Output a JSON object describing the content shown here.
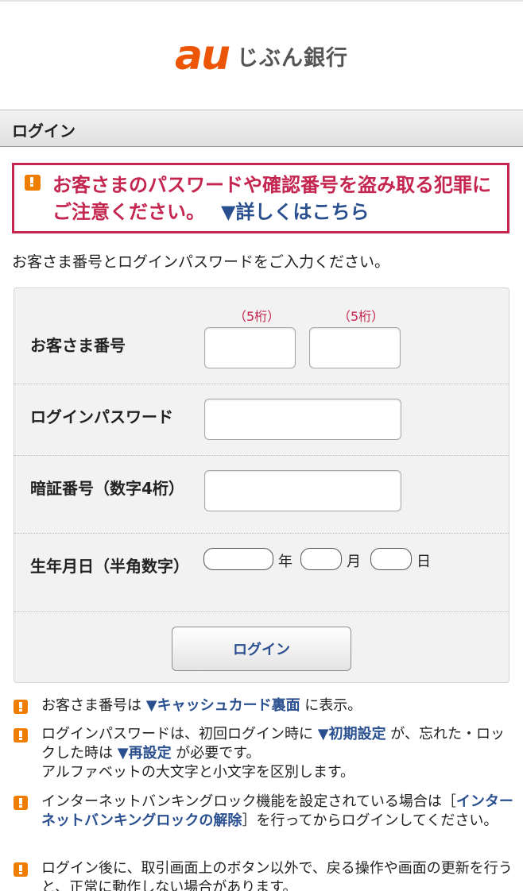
{
  "header": {
    "logo_au": "au",
    "logo_name": "じぶん銀行"
  },
  "title": "ログイン",
  "warning": {
    "text": "お客さまのパスワードや確認番号を盗み取る犯罪にご注意ください。",
    "link": "▼詳しくはこちら"
  },
  "instruction": "お客さま番号とログインパスワードをご入力ください。",
  "form": {
    "customer_number": {
      "label": "お客さま番号",
      "hint1": "（5桁）",
      "hint2": "（5桁）"
    },
    "password": {
      "label": "ログインパスワード"
    },
    "pin": {
      "label": "暗証番号（数字4桁）"
    },
    "birthdate": {
      "label": "生年月日（半角数字）",
      "year": "年",
      "month": "月",
      "day": "日"
    },
    "submit": "ログイン"
  },
  "notes": [
    {
      "before": "お客さま番号は ",
      "link": "▼キャッシュカード裏面",
      "after": " に表示。"
    },
    {
      "before": "ログインパスワードは、初回ログイン時に ",
      "link1": "▼初期設定",
      "mid": " が、忘れた・ロックした時は ",
      "link2": "▼再設定",
      "after": " が必要です。",
      "line2": "アルファベットの大文字と小文字を区別します。"
    },
    {
      "before": "インターネットバンキングロック機能を設定されている場合は［",
      "link": "インターネットバンキングロックの解除",
      "after": "］を行ってからログインしてください。"
    },
    {
      "text": "ログイン後に、取引画面上のボタン以外で、戻る操作や画面の更新を行うと、正常に動作しない場合があります。"
    }
  ],
  "colors": {
    "brand_orange": "#eb5505",
    "warning_red": "#c4264f",
    "link_blue": "#2a4f8f",
    "notice_icon": "#ef7d00"
  }
}
